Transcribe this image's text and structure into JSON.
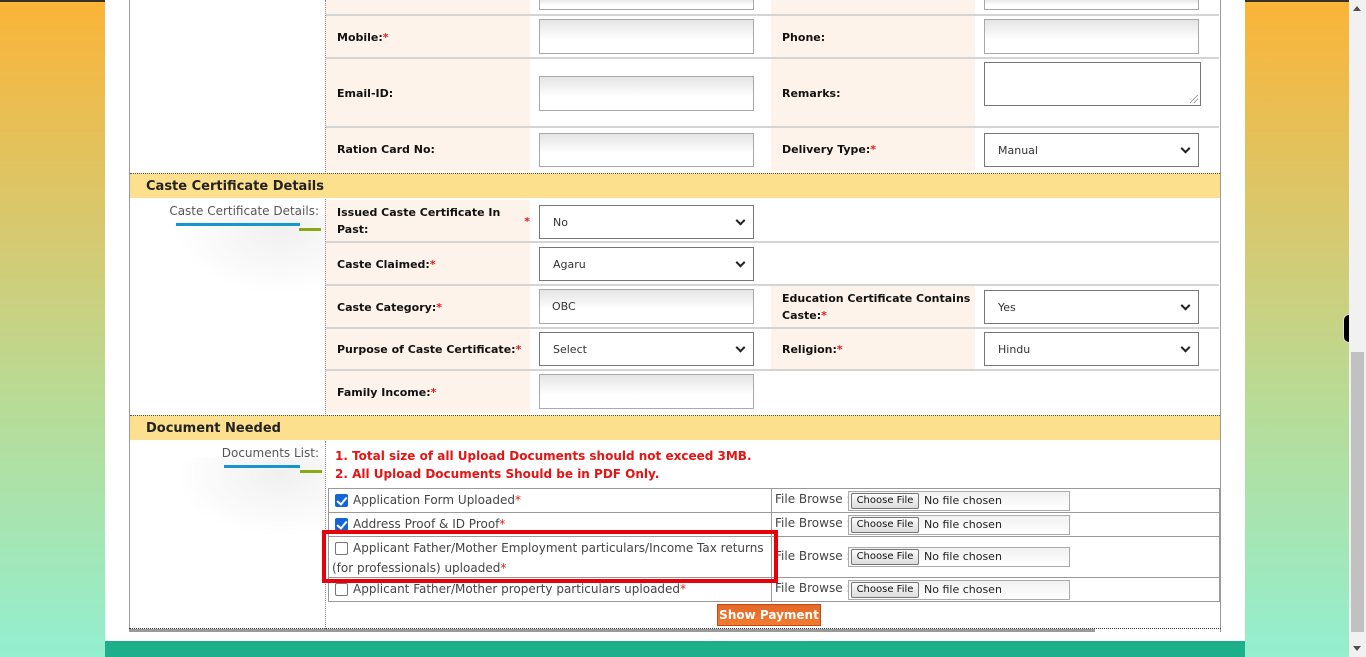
{
  "contact_section": {
    "mobile": {
      "label": "Mobile:",
      "required": true,
      "value": ""
    },
    "phone": {
      "label": "Phone:",
      "required": false,
      "value": ""
    },
    "email": {
      "label": "Email-ID:",
      "required": false,
      "value": ""
    },
    "remarks": {
      "label": "Remarks:",
      "required": false,
      "value": ""
    },
    "ration_card": {
      "label": "Ration Card No:",
      "required": false,
      "value": ""
    },
    "delivery_type": {
      "label": "Delivery Type:",
      "required": true,
      "value": "Manual"
    }
  },
  "caste_section": {
    "title": "Caste Certificate Details",
    "side_label": "Caste Certificate Details:",
    "issued_in_past": {
      "label": "Issued Caste Certificate In Past:",
      "required": true,
      "value": "No"
    },
    "caste_claimed": {
      "label": "Caste Claimed:",
      "required": true,
      "value": "Agaru"
    },
    "caste_category": {
      "label": "Caste Category:",
      "required": true,
      "value": "OBC"
    },
    "education_contains_caste": {
      "label_line1": "Education Certificate Contains",
      "label_line2": "Caste:",
      "required": true,
      "value": "Yes"
    },
    "purpose": {
      "label": "Purpose of Caste Certificate:",
      "required": true,
      "value": "Select"
    },
    "religion": {
      "label": "Religion:",
      "required": true,
      "value": "Hindu"
    },
    "family_income": {
      "label": "Family Income:",
      "required": true,
      "value": ""
    }
  },
  "documents_section": {
    "title": "Document Needed",
    "side_label": "Documents List:",
    "notes": [
      "1. Total size of all Upload Documents should not exceed 3MB.",
      "2. All Upload Documents Should be in PDF Only."
    ],
    "file_browse_label": "File Browse :",
    "choose_file_label": "Choose File",
    "no_file_label": "No file chosen",
    "documents": [
      {
        "label": "Application Form Uploaded",
        "checked": true,
        "required": true
      },
      {
        "label": "Address Proof & ID Proof",
        "checked": true,
        "required": true
      },
      {
        "label": "Applicant Father/Mother Employment particulars/Income Tax returns (for professionals) uploaded",
        "checked": false,
        "required": true,
        "highlighted": true
      },
      {
        "label": "Applicant Father/Mother property particulars uploaded",
        "checked": false,
        "required": true
      }
    ],
    "show_payment_label": "Show Payment"
  },
  "required_marker": "*",
  "colors": {
    "section_header": "#fde08d",
    "label_bg": "#fdf3ea",
    "required": "#e21b1b",
    "highlight_box": "#e8000b",
    "payment_button": "#ea6f2c",
    "footer": "#1bb08a"
  }
}
